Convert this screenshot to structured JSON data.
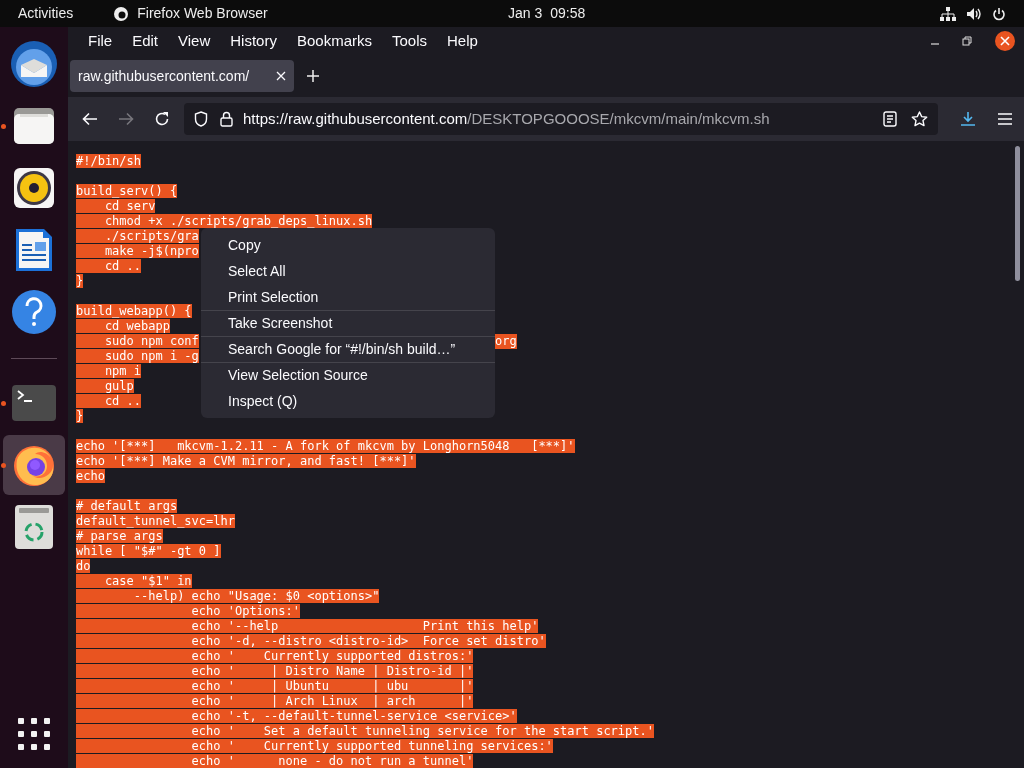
{
  "top_bar": {
    "activities": "Activities",
    "app_name": "Firefox Web Browser",
    "date": "Jan 3",
    "time": "09:58"
  },
  "dock": {
    "items": [
      {
        "kind": "mail",
        "running": false,
        "selected": false
      },
      {
        "kind": "files",
        "running": true,
        "selected": false
      },
      {
        "kind": "music",
        "running": false,
        "selected": false
      },
      {
        "kind": "document",
        "running": false,
        "selected": false
      },
      {
        "kind": "help",
        "running": false,
        "selected": false
      },
      {
        "kind": "separator"
      },
      {
        "kind": "terminal",
        "running": true,
        "selected": false
      },
      {
        "kind": "browser",
        "running": true,
        "selected": true
      },
      {
        "kind": "trash",
        "running": false,
        "selected": false
      }
    ]
  },
  "menu_bar": [
    "File",
    "Edit",
    "View",
    "History",
    "Bookmarks",
    "Tools",
    "Help"
  ],
  "tabs": [
    {
      "title": "raw.githubusercontent.com/",
      "selected": true
    }
  ],
  "url": {
    "host": "https://raw.githubusercontent.com",
    "path": "/DESKTOPGOOOSE/mkcvm/main/mkcvm.sh"
  },
  "code_blocks": [
    [
      {
        "text": "#!/bin/sh"
      }
    ],
    [
      {
        "text": "build_serv() {"
      },
      {
        "text": "    cd serv"
      },
      {
        "text": "    chmod +x ./scripts/grab_deps_linux.sh"
      },
      {
        "text": "    ./scripts/gra"
      },
      {
        "text": "    make -j$(npro"
      },
      {
        "text": "    cd .."
      },
      {
        "text": "}"
      }
    ],
    [
      {
        "text": "build_webapp() {"
      },
      {
        "text": "    cd webapp"
      },
      {
        "text": "    sudo npm conf",
        "tail": "org"
      },
      {
        "text": "    sudo npm i -g"
      },
      {
        "text": "    npm i"
      },
      {
        "text": "    gulp"
      },
      {
        "text": "    cd .."
      },
      {
        "text": "}"
      }
    ],
    [
      {
        "text": "echo '[***]   mkcvm-1.2.11 - A fork of mkcvm by Longhorn5048   [***]'"
      },
      {
        "text": "echo '[***] Make a CVM mirror, and fast! [***]'"
      },
      {
        "text": "echo"
      }
    ],
    [
      {
        "text": "# default args"
      },
      {
        "text": "default_tunnel_svc=lhr"
      },
      {
        "text": "# parse args"
      },
      {
        "text": "while [ \"$#\" -gt 0 ]"
      },
      {
        "text": "do"
      },
      {
        "text": "    case \"$1\" in"
      },
      {
        "text": "        --help) echo \"Usage: $0 <options>\""
      },
      {
        "text": "                echo 'Options:'"
      },
      {
        "text": "                echo '--help                    Print this help'"
      },
      {
        "text": "                echo '-d, --distro <distro-id>  Force set distro'"
      },
      {
        "text": "                echo '    Currently supported distros:'"
      },
      {
        "text": "                echo '     | Distro Name | Distro-id |'"
      },
      {
        "text": "                echo '     | Ubuntu      | ubu       |'"
      },
      {
        "text": "                echo '     | Arch Linux  | arch      |'"
      },
      {
        "text": "                echo '-t, --default-tunnel-service <service>'"
      },
      {
        "text": "                echo '    Set a default tunneling service for the start script.'"
      },
      {
        "text": "                echo '    Currently supported tunneling services:'"
      },
      {
        "text": "                echo '      none - do not run a tunnel'"
      }
    ]
  ],
  "context_menu": [
    {
      "label": "Copy",
      "separator_before": false
    },
    {
      "label": "Select All",
      "separator_before": false
    },
    {
      "label": "Print Selection",
      "separator_before": false
    },
    {
      "label": "Take Screenshot",
      "separator_before": true
    },
    {
      "label": "Search Google for “#!/bin/sh build…”",
      "separator_before": true
    },
    {
      "label": "View Selection Source",
      "separator_before": true
    },
    {
      "label": "Inspect (Q)",
      "separator_before": false
    }
  ]
}
